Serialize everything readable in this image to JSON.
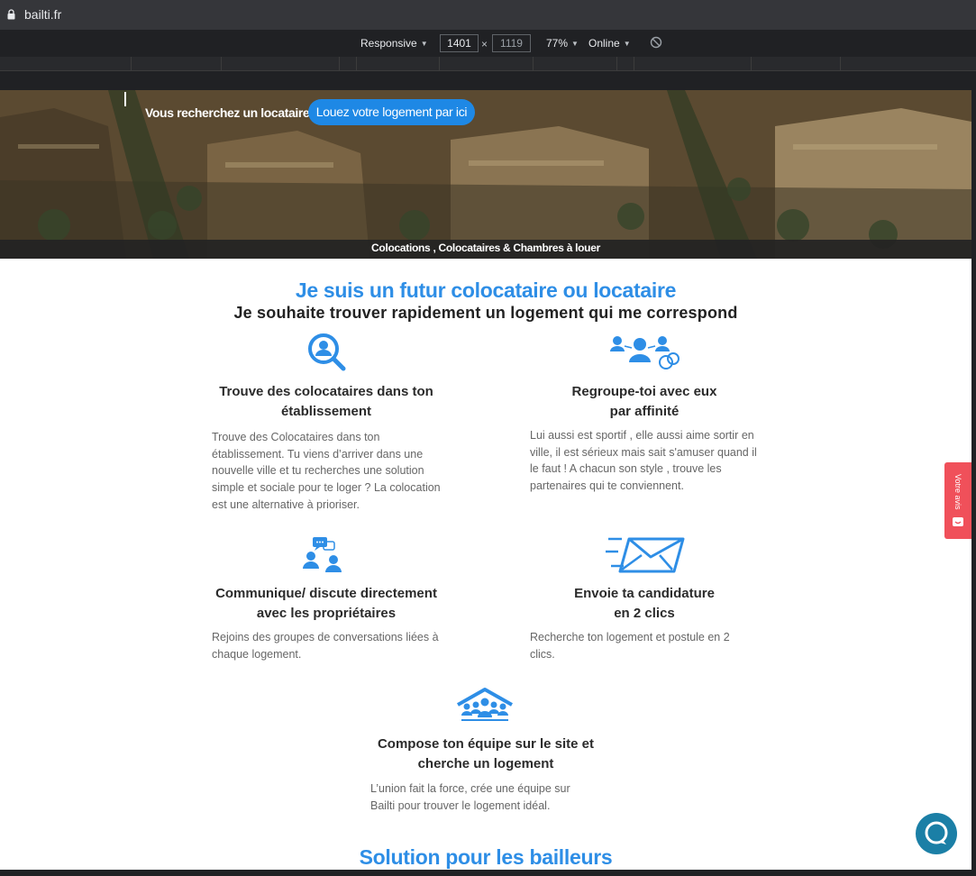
{
  "browser": {
    "url": "bailti.fr",
    "device_mode": "Responsive",
    "width": "1401",
    "height": "1119",
    "zoom": "77%",
    "network": "Online"
  },
  "hero": {
    "question": "Vous recherchez un locataire ?",
    "cta": "Louez votre logement par ici",
    "caption": "Colocations , Colocataires & Chambres à louer"
  },
  "intro": {
    "title": "Je suis un futur colocataire ou locataire",
    "subtitle": "Je souhaite trouver rapidement un logement qui me correspond"
  },
  "features": [
    {
      "title_line1": "Trouve des colocataires dans ton",
      "title_line2": "établissement",
      "text": "Trouve des Colocataires dans ton établissement. Tu viens d’arriver dans une nouvelle ville et tu recherches une solution simple et sociale pour te loger ? La colocation est une alternative à prioriser.",
      "icon": "magnifier-user-icon"
    },
    {
      "title_line1": "Regroupe-toi avec eux",
      "title_line2": "par affinité",
      "text": "Lui aussi est sportif , elle aussi aime sortir en ville, il est sérieux mais sait s'amuser quand il le faut ! A chacun son style , trouve les partenaires qui te conviennent.",
      "icon": "group-affinity-icon"
    },
    {
      "title_line1": "Communique/ discute directement",
      "title_line2": "avec les propriétaires",
      "text": "Rejoins des groupes de conversations liées à chaque logement.",
      "icon": "chat-users-icon"
    },
    {
      "title_line1": "Envoie ta candidature",
      "title_line2": "en 2 clics",
      "text": "Recherche ton logement et postule en 2 clics.",
      "icon": "fast-envelope-icon"
    },
    {
      "title_line1": "Compose ton équipe sur le site et",
      "title_line2": "cherche un logement",
      "text": "L’union fait la force, crée une équipe sur Bailti pour trouver le logement idéal.",
      "icon": "team-house-icon"
    }
  ],
  "landlords": {
    "title": "Solution pour les bailleurs"
  },
  "widgets": {
    "reviews_tab": "Votre avis"
  },
  "colors": {
    "accent": "#2e8ee6",
    "cta": "#1e88e5",
    "reviews": "#f0505a",
    "chat": "#1b7fa6"
  }
}
